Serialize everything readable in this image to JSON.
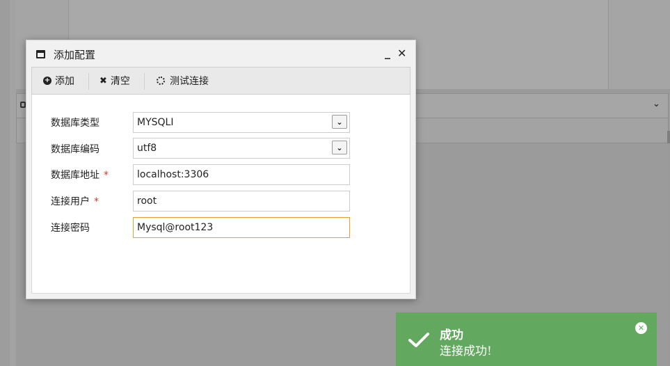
{
  "dialog": {
    "title": "添加配置",
    "minimize_glyph": "_",
    "close_glyph": "✕",
    "icon": "window-icon"
  },
  "toolbar": {
    "add_label": "添加",
    "add_icon": "plus-circle-icon",
    "clear_label": "清空",
    "clear_icon": "x-icon",
    "test_label": "测试连接",
    "test_icon": "spinner-icon"
  },
  "form": {
    "db_type": {
      "label": "数据库类型",
      "value": "MYSQLI",
      "required": false
    },
    "db_encoding": {
      "label": "数据库编码",
      "value": "utf8",
      "required": false
    },
    "db_address": {
      "label": "数据库地址",
      "value": "localhost:3306",
      "required": true
    },
    "conn_user": {
      "label": "连接用户",
      "value": "root",
      "required": true
    },
    "conn_password": {
      "label": "连接密码",
      "value": "Mysql@root123",
      "required": false
    },
    "required_mark": "*"
  },
  "toast": {
    "title": "成功",
    "message": "连接成功!",
    "icon": "check-icon",
    "close_glyph": "✕",
    "color": "#62a85f"
  },
  "colors": {
    "overlay": "#9a9a9a",
    "focus_border": "#e4a02b",
    "required": "#d9362b"
  }
}
